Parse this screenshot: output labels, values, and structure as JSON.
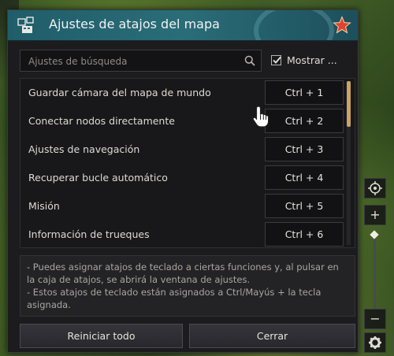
{
  "window": {
    "title": "Ajustes de atajos del mapa",
    "title_icon": "keyboard-map-icon",
    "close_icon": "star-close-icon"
  },
  "search": {
    "placeholder": "Ajustes de búsqueda",
    "icon": "search-icon"
  },
  "show_all": {
    "label": "Mostrar ...",
    "checked": true
  },
  "shortcuts": [
    {
      "label": "Guardar cámara del mapa de mundo",
      "key": "Ctrl + 1"
    },
    {
      "label": "Conectar nodos directamente",
      "key": "Ctrl + 2"
    },
    {
      "label": "Ajustes de navegación",
      "key": "Ctrl + 3"
    },
    {
      "label": "Recuperar bucle automático",
      "key": "Ctrl + 4"
    },
    {
      "label": "Misión",
      "key": "Ctrl + 5"
    },
    {
      "label": "Información de trueques",
      "key": "Ctrl + 6"
    }
  ],
  "info": {
    "line1": "- Puedes asignar atajos de teclado a ciertas funciones y, al pulsar en la caja de atajos, se abrirá la ventana de ajustes.",
    "line2": "- Estos atajos de teclado están asignados a Ctrl/Mayús + la tecla asignada."
  },
  "buttons": {
    "reset": "Reiniciar todo",
    "close": "Cerrar"
  },
  "side_controls": {
    "zoom_in": "+",
    "zoom_out": "−"
  },
  "colors": {
    "title_bar": "#2a6d78",
    "accent_scroll": "#c9a36a",
    "close_star": "#e0432f"
  }
}
